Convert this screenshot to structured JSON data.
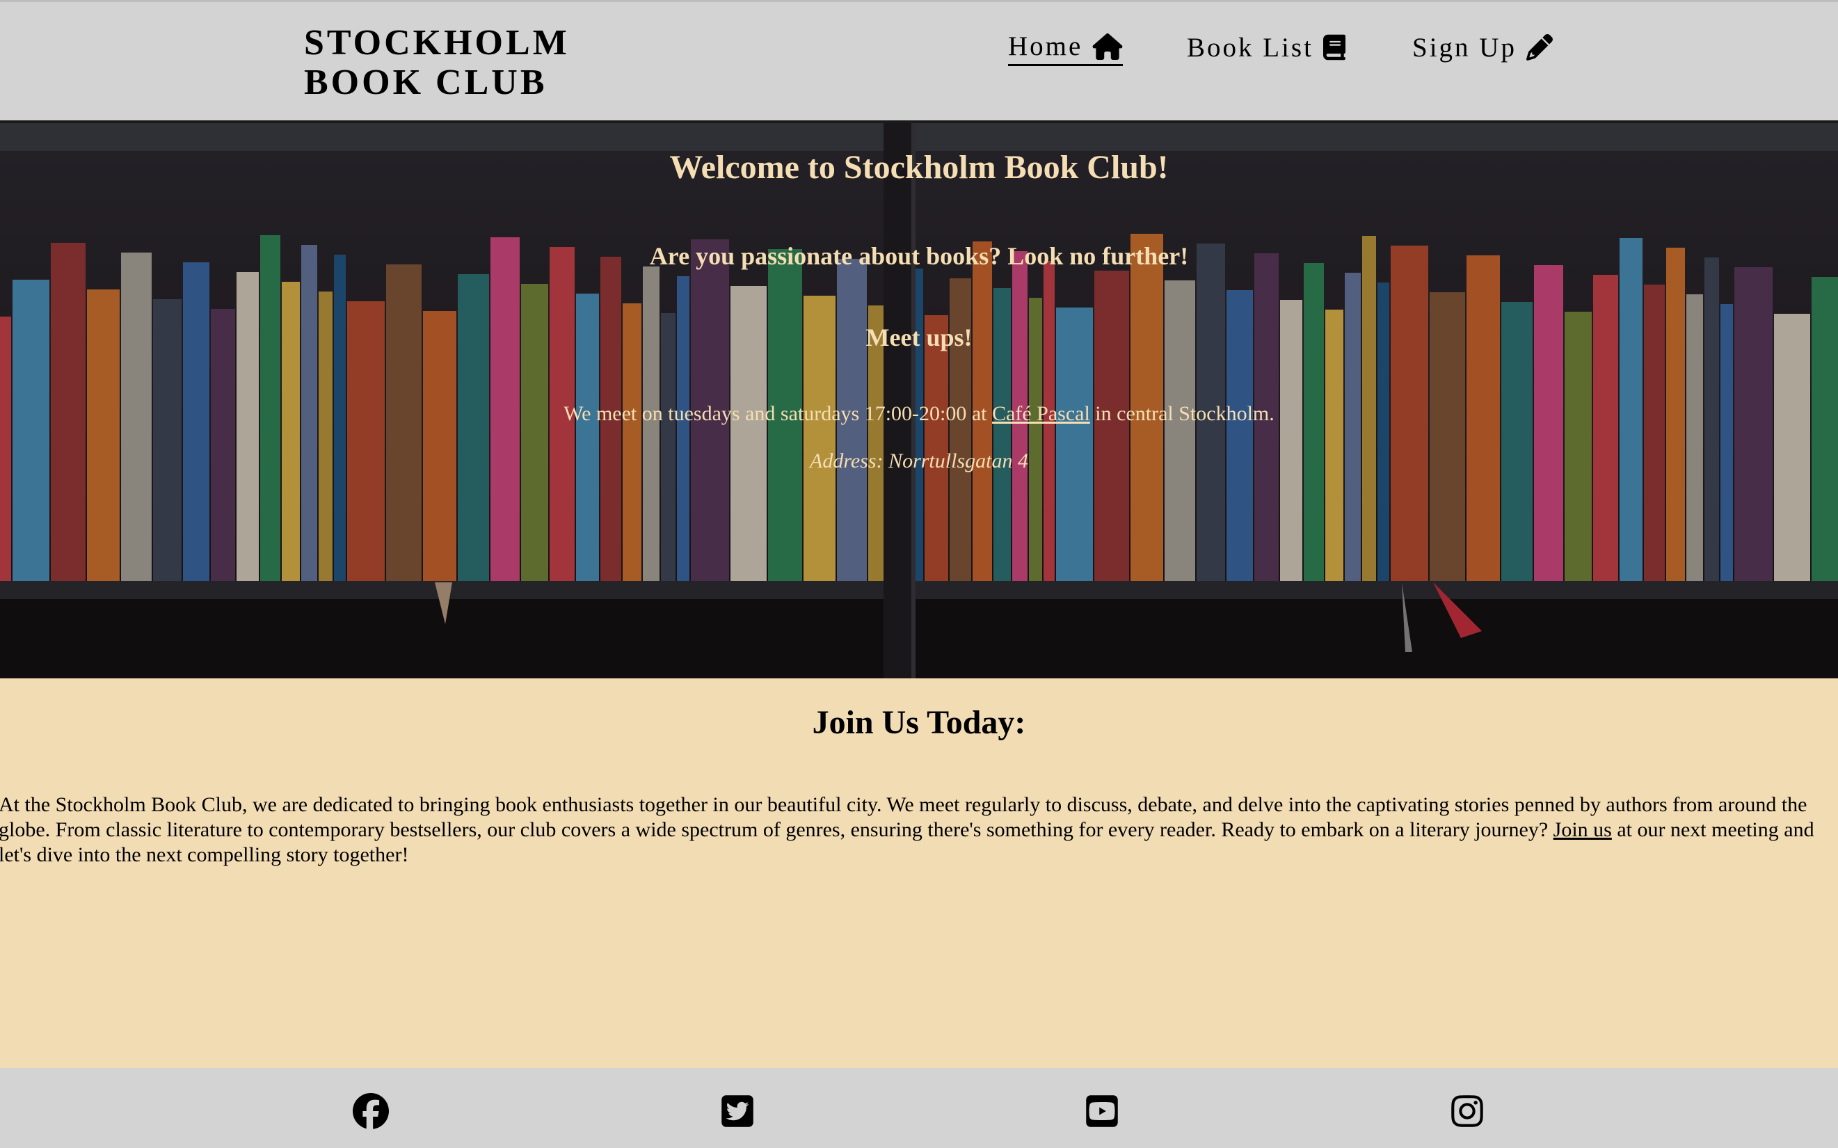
{
  "header": {
    "logo_line1": "STOCKHOLM",
    "logo_line2": "BOOK CLUB",
    "nav": {
      "home": "Home",
      "home_icon": "home-icon",
      "book_list": "Book List",
      "book_list_icon": "book-icon",
      "sign_up": "Sign Up",
      "sign_up_icon": "pencil-icon"
    }
  },
  "hero": {
    "title": "Welcome to Stockholm Book Club!",
    "subtitle": "Are you passionate about books? Look no further!",
    "meet": "Meet ups!",
    "times_prefix": "We meet on tuesdays and saturdays 17:00-20:00 at ",
    "cafe_link": "Café Pascal",
    "times_suffix": " in central Stockholm.",
    "address": "Address: Norrtullsgatan 4"
  },
  "join": {
    "title": "Join Us Today:",
    "text_before": "At the Stockholm Book Club, we are dedicated to bringing book enthusiasts together in our beautiful city. We meet regularly to discuss, debate, and delve into the captivating stories penned by authors from around the globe. From classic literature to contemporary bestsellers, our club covers a wide spectrum of genres, ensuring there's something for every reader. Ready to embark on a literary journey? ",
    "join_link": "Join us",
    "text_after": " at our next meeting and let's dive into the next compelling story together!"
  },
  "footer": {
    "icons": [
      "facebook-icon",
      "twitter-icon",
      "youtube-icon",
      "instagram-icon"
    ]
  },
  "colors": {
    "header_bg": "#d3d3d3",
    "hero_text": "#f5deb3",
    "page_bg": "#f2dcb4"
  }
}
